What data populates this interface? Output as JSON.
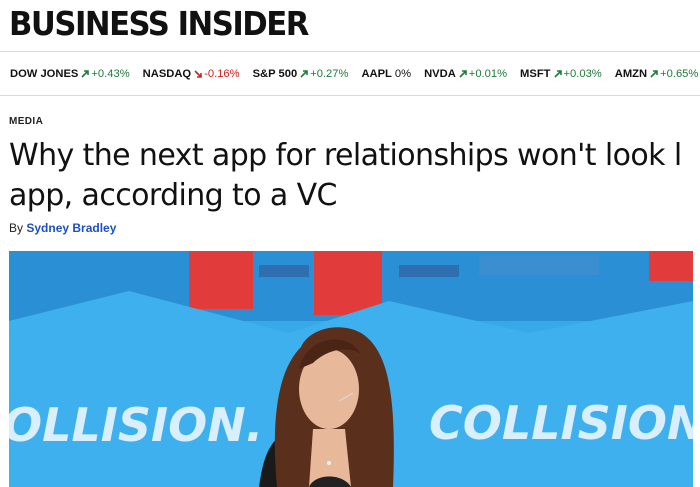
{
  "site": {
    "logo_text": "BUSINESS INSIDER"
  },
  "ticker": [
    {
      "symbol": "DOW JONES",
      "direction": "up",
      "change": "+0.43%"
    },
    {
      "symbol": "NASDAQ",
      "direction": "down",
      "change": "-0.16%"
    },
    {
      "symbol": "S&P 500",
      "direction": "up",
      "change": "+0.27%"
    },
    {
      "symbol": "AAPL",
      "direction": "flat",
      "change": "0%"
    },
    {
      "symbol": "NVDA",
      "direction": "up",
      "change": "+0.01%"
    },
    {
      "symbol": "MSFT",
      "direction": "up",
      "change": "+0.03%"
    },
    {
      "symbol": "AMZN",
      "direction": "up",
      "change": "+0.65%"
    }
  ],
  "article": {
    "category": "MEDIA",
    "headline_line1": "Why the next app for relationships won't look l",
    "headline_line2": "app, according to a VC",
    "byline_prefix": "By",
    "author": "Sydney Bradley"
  },
  "hero": {
    "banner_text_left": "OLLISION.",
    "banner_text_right": "COLLISION"
  },
  "colors": {
    "up": "#1f7a3a",
    "down": "#d3201b",
    "link": "#1d4fc4",
    "hero_blue": "#33a6e6",
    "hero_red": "#e23b3b"
  }
}
